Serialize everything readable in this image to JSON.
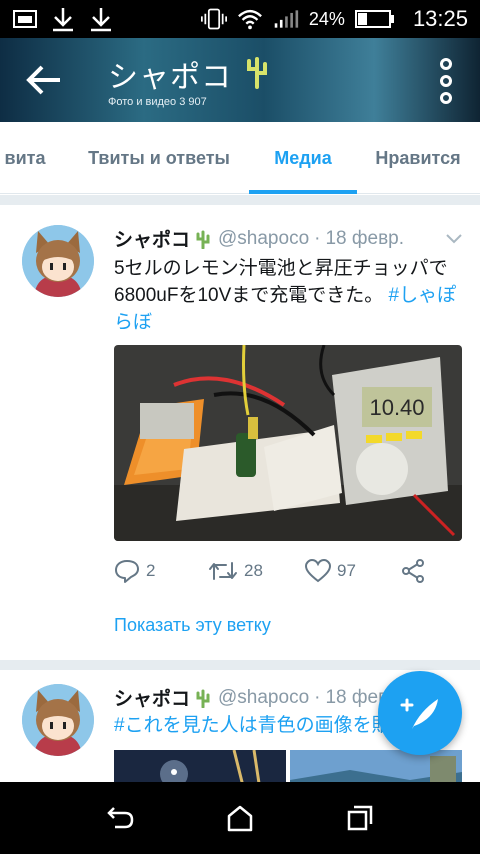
{
  "status_bar": {
    "battery": "24%",
    "time": "13:25",
    "icons": [
      "gallery-icon",
      "download-icon",
      "download-icon",
      "vibrate-icon",
      "wifi-icon",
      "signal-icon",
      "battery-icon"
    ]
  },
  "header": {
    "title": "シャポコ",
    "subtitle": "Фото и видео 3 907",
    "back_icon": "arrow-left-icon",
    "more_icon": "more-vert-icon"
  },
  "tabs": [
    {
      "label": "вита"
    },
    {
      "label": "Твиты и ответы"
    },
    {
      "label": "Медиа",
      "active": true
    },
    {
      "label": "Нравится"
    }
  ],
  "tweets": [
    {
      "name": "シャポコ",
      "handle": "@shapoco",
      "dot": "·",
      "date": "18 февр.",
      "text": "5セルのレモン汁電池と昇圧チョッパで6800uFを10Vまで充電できた。",
      "hashtag": "#しゃぽらぼ",
      "replies": "2",
      "retweets": "28",
      "likes": "97",
      "thread_link": "Показать эту ветку",
      "meter_reading": "10.40"
    },
    {
      "name": "シャポコ",
      "handle": "@shapoco",
      "dot": "·",
      "date": "18 февр.",
      "text_hashtag": "#これを見た人は青色の画像を貼"
    }
  ],
  "colors": {
    "accent": "#1da1f2",
    "muted": "#657786",
    "divider": "#e6ecf0"
  }
}
